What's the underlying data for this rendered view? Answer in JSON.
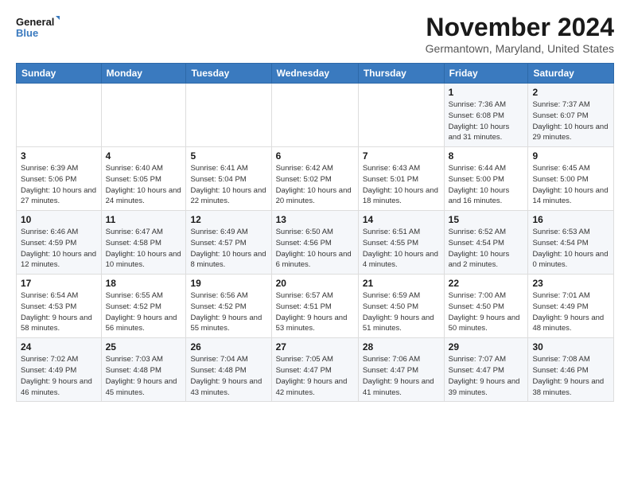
{
  "logo": {
    "line1": "General",
    "line2": "Blue"
  },
  "header": {
    "month": "November 2024",
    "location": "Germantown, Maryland, United States"
  },
  "weekdays": [
    "Sunday",
    "Monday",
    "Tuesday",
    "Wednesday",
    "Thursday",
    "Friday",
    "Saturday"
  ],
  "weeks": [
    [
      {
        "day": "",
        "info": ""
      },
      {
        "day": "",
        "info": ""
      },
      {
        "day": "",
        "info": ""
      },
      {
        "day": "",
        "info": ""
      },
      {
        "day": "",
        "info": ""
      },
      {
        "day": "1",
        "info": "Sunrise: 7:36 AM\nSunset: 6:08 PM\nDaylight: 10 hours\nand 31 minutes."
      },
      {
        "day": "2",
        "info": "Sunrise: 7:37 AM\nSunset: 6:07 PM\nDaylight: 10 hours\nand 29 minutes."
      }
    ],
    [
      {
        "day": "3",
        "info": "Sunrise: 6:39 AM\nSunset: 5:06 PM\nDaylight: 10 hours\nand 27 minutes."
      },
      {
        "day": "4",
        "info": "Sunrise: 6:40 AM\nSunset: 5:05 PM\nDaylight: 10 hours\nand 24 minutes."
      },
      {
        "day": "5",
        "info": "Sunrise: 6:41 AM\nSunset: 5:04 PM\nDaylight: 10 hours\nand 22 minutes."
      },
      {
        "day": "6",
        "info": "Sunrise: 6:42 AM\nSunset: 5:02 PM\nDaylight: 10 hours\nand 20 minutes."
      },
      {
        "day": "7",
        "info": "Sunrise: 6:43 AM\nSunset: 5:01 PM\nDaylight: 10 hours\nand 18 minutes."
      },
      {
        "day": "8",
        "info": "Sunrise: 6:44 AM\nSunset: 5:00 PM\nDaylight: 10 hours\nand 16 minutes."
      },
      {
        "day": "9",
        "info": "Sunrise: 6:45 AM\nSunset: 5:00 PM\nDaylight: 10 hours\nand 14 minutes."
      }
    ],
    [
      {
        "day": "10",
        "info": "Sunrise: 6:46 AM\nSunset: 4:59 PM\nDaylight: 10 hours\nand 12 minutes."
      },
      {
        "day": "11",
        "info": "Sunrise: 6:47 AM\nSunset: 4:58 PM\nDaylight: 10 hours\nand 10 minutes."
      },
      {
        "day": "12",
        "info": "Sunrise: 6:49 AM\nSunset: 4:57 PM\nDaylight: 10 hours\nand 8 minutes."
      },
      {
        "day": "13",
        "info": "Sunrise: 6:50 AM\nSunset: 4:56 PM\nDaylight: 10 hours\nand 6 minutes."
      },
      {
        "day": "14",
        "info": "Sunrise: 6:51 AM\nSunset: 4:55 PM\nDaylight: 10 hours\nand 4 minutes."
      },
      {
        "day": "15",
        "info": "Sunrise: 6:52 AM\nSunset: 4:54 PM\nDaylight: 10 hours\nand 2 minutes."
      },
      {
        "day": "16",
        "info": "Sunrise: 6:53 AM\nSunset: 4:54 PM\nDaylight: 10 hours\nand 0 minutes."
      }
    ],
    [
      {
        "day": "17",
        "info": "Sunrise: 6:54 AM\nSunset: 4:53 PM\nDaylight: 9 hours\nand 58 minutes."
      },
      {
        "day": "18",
        "info": "Sunrise: 6:55 AM\nSunset: 4:52 PM\nDaylight: 9 hours\nand 56 minutes."
      },
      {
        "day": "19",
        "info": "Sunrise: 6:56 AM\nSunset: 4:52 PM\nDaylight: 9 hours\nand 55 minutes."
      },
      {
        "day": "20",
        "info": "Sunrise: 6:57 AM\nSunset: 4:51 PM\nDaylight: 9 hours\nand 53 minutes."
      },
      {
        "day": "21",
        "info": "Sunrise: 6:59 AM\nSunset: 4:50 PM\nDaylight: 9 hours\nand 51 minutes."
      },
      {
        "day": "22",
        "info": "Sunrise: 7:00 AM\nSunset: 4:50 PM\nDaylight: 9 hours\nand 50 minutes."
      },
      {
        "day": "23",
        "info": "Sunrise: 7:01 AM\nSunset: 4:49 PM\nDaylight: 9 hours\nand 48 minutes."
      }
    ],
    [
      {
        "day": "24",
        "info": "Sunrise: 7:02 AM\nSunset: 4:49 PM\nDaylight: 9 hours\nand 46 minutes."
      },
      {
        "day": "25",
        "info": "Sunrise: 7:03 AM\nSunset: 4:48 PM\nDaylight: 9 hours\nand 45 minutes."
      },
      {
        "day": "26",
        "info": "Sunrise: 7:04 AM\nSunset: 4:48 PM\nDaylight: 9 hours\nand 43 minutes."
      },
      {
        "day": "27",
        "info": "Sunrise: 7:05 AM\nSunset: 4:47 PM\nDaylight: 9 hours\nand 42 minutes."
      },
      {
        "day": "28",
        "info": "Sunrise: 7:06 AM\nSunset: 4:47 PM\nDaylight: 9 hours\nand 41 minutes."
      },
      {
        "day": "29",
        "info": "Sunrise: 7:07 AM\nSunset: 4:47 PM\nDaylight: 9 hours\nand 39 minutes."
      },
      {
        "day": "30",
        "info": "Sunrise: 7:08 AM\nSunset: 4:46 PM\nDaylight: 9 hours\nand 38 minutes."
      }
    ]
  ]
}
